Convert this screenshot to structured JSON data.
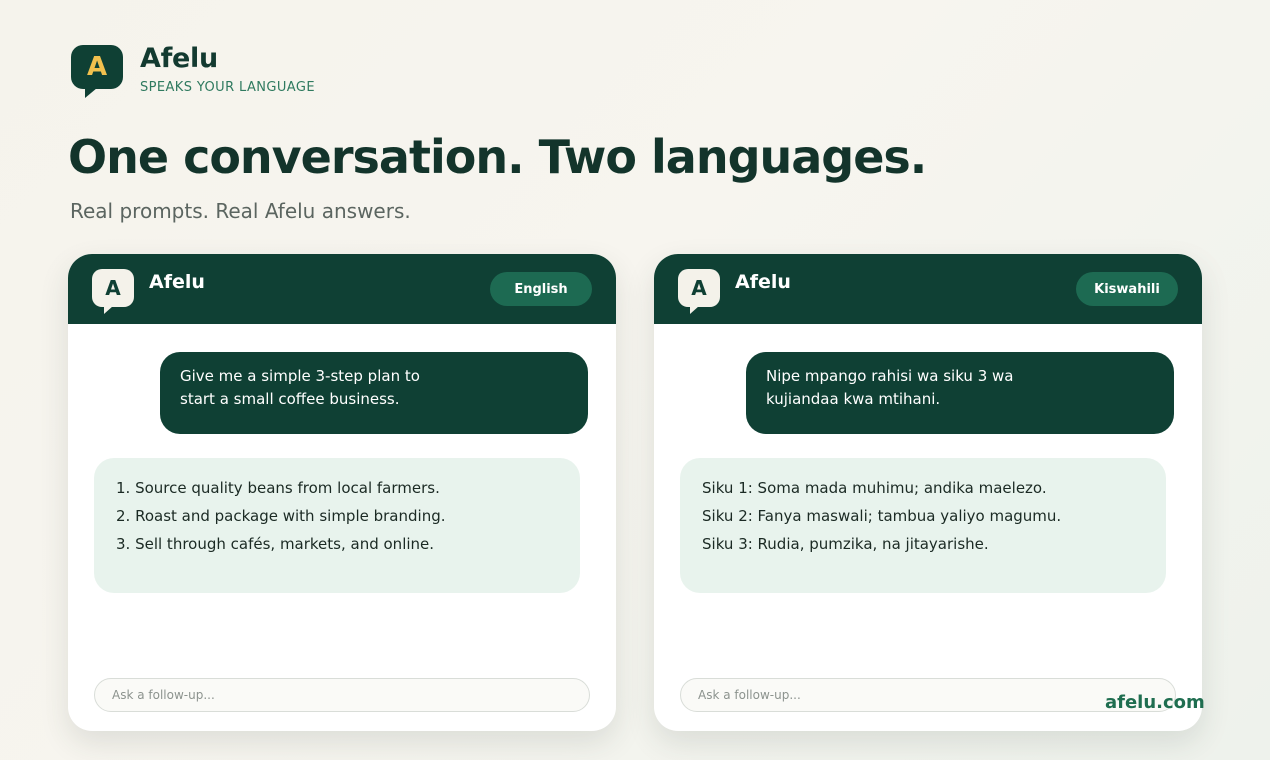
{
  "brand": {
    "logo_letter": "A",
    "name": "Afelu",
    "tagline": "SPEAKS YOUR LANGUAGE"
  },
  "headline": "One conversation. Two languages.",
  "subheadline": "Real prompts. Real Afelu answers.",
  "panels": [
    {
      "assistant_name": "Afelu",
      "logo_letter": "A",
      "language": "English",
      "user_prompt": "Give me a simple 3-step plan to start a small coffee business.",
      "reply_lines": [
        "1. Source quality beans from local farmers.",
        "2. Roast and package with simple branding.",
        "3. Sell through cafés, markets, and online."
      ],
      "input_placeholder": "Ask a follow-up..."
    },
    {
      "assistant_name": "Afelu",
      "logo_letter": "A",
      "language": "Kiswahili",
      "user_prompt": "Nipe mpango rahisi wa siku 3 wa kujiandaa kwa mtihani.",
      "reply_lines": [
        "Siku 1: Soma mada muhimu; andika maelezo.",
        "Siku 2: Fanya maswali; tambua yaliyo magumu.",
        "Siku 3: Rudia, pumzika, na jitayarishe."
      ],
      "input_placeholder": "Ask a follow-up..."
    }
  ],
  "footer_url": "afelu.com",
  "colors": {
    "brand_dark_green": "#0f4034",
    "accent_yellow": "#f2c14e",
    "pill_green": "#1d6a52",
    "reply_bg": "#e8f3ed",
    "url_green": "#1f6e50"
  }
}
